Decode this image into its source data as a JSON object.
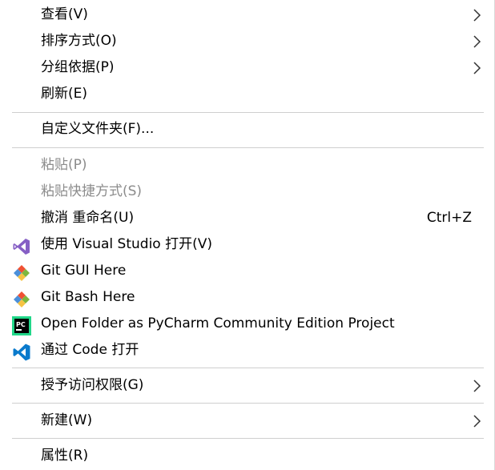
{
  "menu": {
    "view": {
      "label": "查看(V)"
    },
    "sort": {
      "label": "排序方式(O)"
    },
    "group": {
      "label": "分组依据(P)"
    },
    "refresh": {
      "label": "刷新(E)"
    },
    "customize": {
      "label": "自定义文件夹(F)..."
    },
    "paste": {
      "label": "粘贴(P)"
    },
    "paste_shortcut": {
      "label": "粘贴快捷方式(S)"
    },
    "undo_rename": {
      "label": "撤消 重命名(U)",
      "shortcut": "Ctrl+Z"
    },
    "open_vs": {
      "label": "使用 Visual Studio 打开(V)",
      "icon": "visual-studio-icon"
    },
    "git_gui": {
      "label": "Git GUI Here",
      "icon": "git-icon"
    },
    "git_bash": {
      "label": "Git Bash Here",
      "icon": "git-icon"
    },
    "pycharm": {
      "label": "Open Folder as PyCharm Community Edition Project",
      "icon": "pycharm-icon"
    },
    "vscode": {
      "label": "通过 Code 打开",
      "icon": "vscode-icon"
    },
    "grant_access": {
      "label": "授予访问权限(G)"
    },
    "new": {
      "label": "新建(W)"
    },
    "properties": {
      "label": "属性(R)"
    }
  },
  "colors": {
    "vs_purple": "#865fc5",
    "git_red": "#f05133",
    "git_green": "#7db73e",
    "git_blue": "#4b8fd9",
    "git_yellow": "#f6c343",
    "vscode_blue": "#0a7acc",
    "pycharm_green": "#21d789"
  }
}
